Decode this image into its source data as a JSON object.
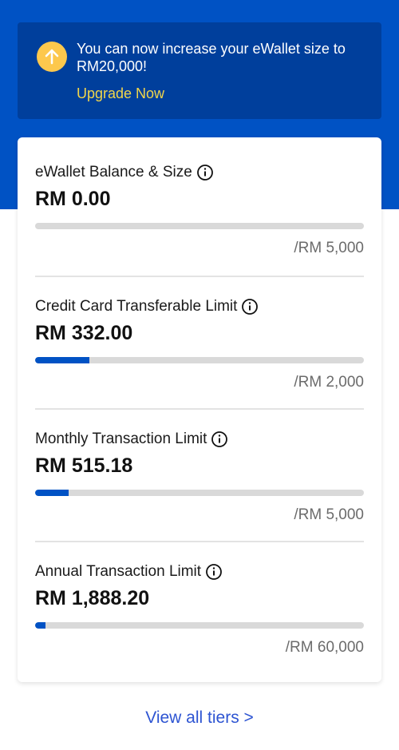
{
  "banner": {
    "icon": "arrow-up-icon",
    "message": "You can now increase your eWallet size to RM20,000!",
    "link_label": "Upgrade Now"
  },
  "limits": [
    {
      "label": "eWallet Balance & Size",
      "amount": "RM 0.00",
      "limit": "/RM 5,000",
      "progress": 0.0
    },
    {
      "label": "Credit Card Transferable Limit",
      "amount": "RM 332.00",
      "limit": "/RM 2,000",
      "progress": 0.166
    },
    {
      "label": "Monthly Transaction Limit",
      "amount": "RM 515.18",
      "limit": "/RM 5,000",
      "progress": 0.103
    },
    {
      "label": "Annual Transaction Limit",
      "amount": "RM 1,888.20",
      "limit": "/RM 60,000",
      "progress": 0.031
    }
  ],
  "footer": {
    "view_all_label": "View all tiers >"
  },
  "colors": {
    "brand_blue": "#0052c4",
    "banner_blue": "#003f9c",
    "accent_yellow": "#fdc84d",
    "link_yellow": "#f2d64a",
    "link_blue": "#2d54d2"
  }
}
